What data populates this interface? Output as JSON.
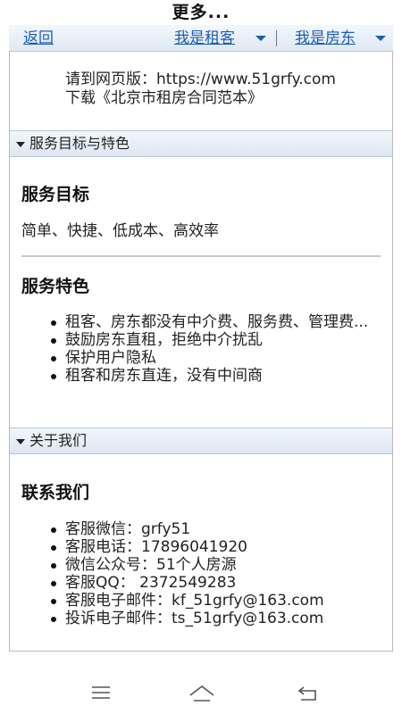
{
  "title": "更多...",
  "nav": {
    "back": "返回",
    "tenant": "我是租客",
    "landlord": "我是房东"
  },
  "top": {
    "line1": "请到网页版：https://www.51grfy.com",
    "line2": "下载《北京市租房合同范本》"
  },
  "section1": {
    "header": "服务目标与特色",
    "goal_title": "服务目标",
    "goal_text": "简单、快捷、低成本、高效率",
    "features_title": "服务特色",
    "features": [
      "租客、房东都没有中介费、服务费、管理费...",
      "鼓励房东直租，拒绝中介扰乱",
      "保护用户隐私",
      "租客和房东直连，没有中间商"
    ]
  },
  "section2": {
    "header": "关于我们",
    "contact_title": "联系我们",
    "contacts": [
      "客服微信：grfy51",
      "客服电话：17896041920",
      "微信公众号：51个人房源",
      "客服QQ：  2372549283",
      "客服电子邮件：kf_51grfy@163.com",
      "投诉电子邮件：ts_51grfy@163.com"
    ]
  },
  "icons": {
    "menu": "menu-icon",
    "home": "home-icon",
    "back": "back-icon"
  },
  "colors": {
    "link": "#1a5fb4",
    "header_bg": "#dde7f2"
  }
}
